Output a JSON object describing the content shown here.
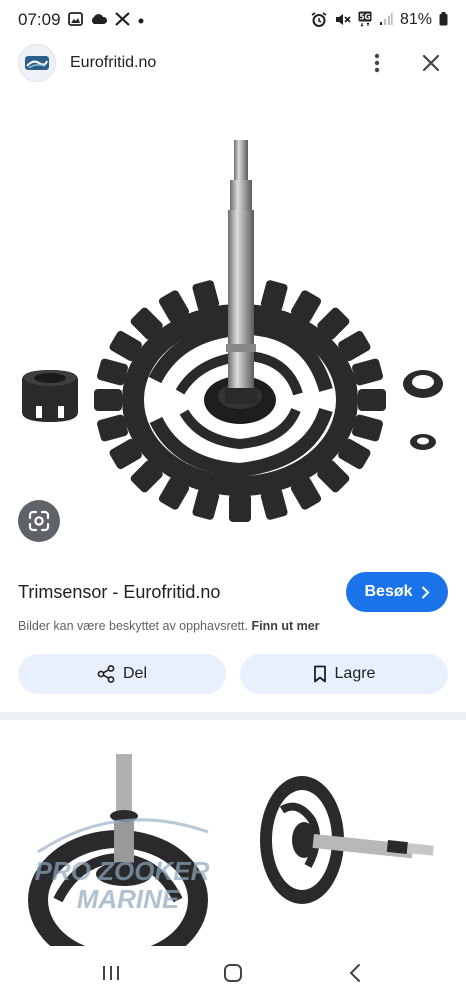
{
  "status_bar": {
    "time": "07:09",
    "left_icons": [
      "image-icon",
      "cloud-icon",
      "x-icon",
      "dot-icon"
    ],
    "right_icons": [
      "alarm-icon",
      "mute-icon",
      "5g-icon",
      "signal-icon"
    ],
    "network": "5G",
    "battery": "81%"
  },
  "header": {
    "site_name": "Eurofritid.no",
    "more_icon": "more-vert-icon",
    "close_icon": "close-icon"
  },
  "image": {
    "lens_icon": "google-lens-icon"
  },
  "result": {
    "title": "Trimsensor - Eurofritid.no",
    "visit_label": "Besøk",
    "copyright_text": "Bilder kan være beskyttet av opphavsrett.",
    "learn_more": "Finn ut mer"
  },
  "actions": {
    "share_label": "Del",
    "save_label": "Lagre"
  },
  "related": {
    "card1_watermark_top": "PRO ZOOKER",
    "card1_watermark_bottom": "MARINE"
  },
  "nav": {
    "recents_icon": "recents-icon",
    "home_icon": "home-icon",
    "back_icon": "back-icon"
  },
  "colors": {
    "accent": "#1a73e8",
    "pill_bg": "#e8f0fe",
    "gear": "#2a2a2c"
  }
}
